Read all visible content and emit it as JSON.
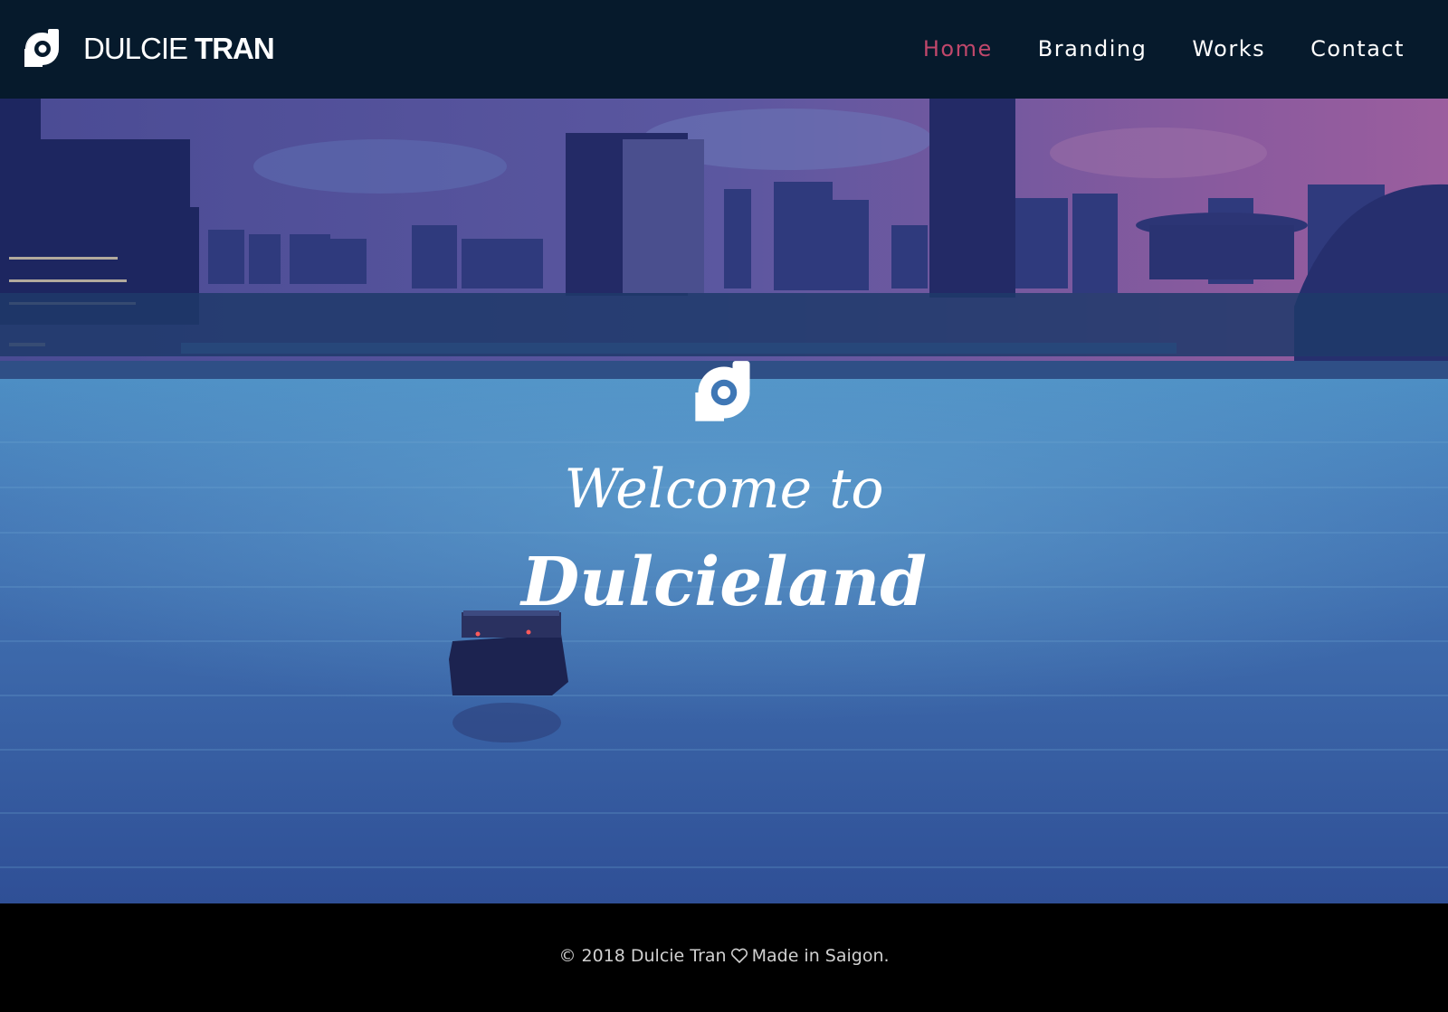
{
  "header": {
    "brand": {
      "first": "DULCIE",
      "last": "TRAN",
      "logo_icon": "dt-monogram-icon"
    },
    "nav": [
      {
        "label": "Home",
        "active": true
      },
      {
        "label": "Branding",
        "active": false
      },
      {
        "label": "Works",
        "active": false
      },
      {
        "label": "Contact",
        "active": false
      }
    ]
  },
  "hero": {
    "logo_icon": "dt-monogram-icon",
    "welcome": "Welcome to",
    "site_name": "Dulcieland",
    "background": "city-skyline-river-photo"
  },
  "footer": {
    "copyright": "© 2018 Dulcie Tran",
    "heart_icon": "heart-outline-icon",
    "made_in": "Made in Saigon."
  },
  "colors": {
    "header_bg": "#061a2c",
    "nav_active": "#c0476b",
    "nav_text": "#ffffff",
    "footer_bg": "#000000"
  }
}
